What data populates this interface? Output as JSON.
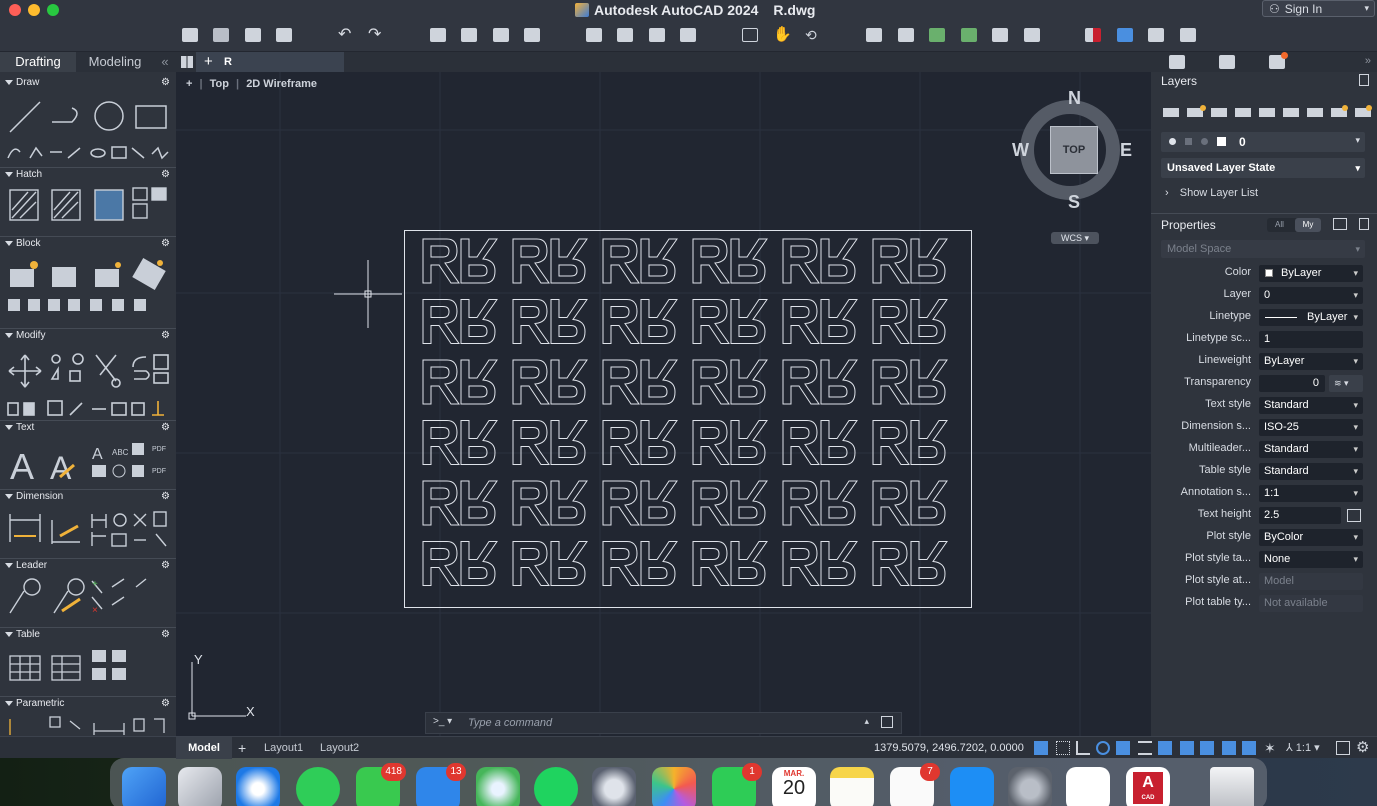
{
  "window": {
    "title": "Autodesk AutoCAD 2024",
    "filename": "R.dwg",
    "signin": "Sign In"
  },
  "left_tabs": {
    "drafting": "Drafting",
    "modeling": "Modeling",
    "collapse": "«"
  },
  "file_tab": {
    "name": "R"
  },
  "viewport": {
    "plus": "+",
    "view": "Top",
    "style": "2D Wireframe"
  },
  "viewcube": {
    "n": "N",
    "s": "S",
    "e": "E",
    "w": "W",
    "face": "TOP",
    "wcs": "WCS"
  },
  "ucs": {
    "x": "X",
    "y": "Y"
  },
  "palette_sections": [
    "Draw",
    "Hatch",
    "Block",
    "Modify",
    "Text",
    "Dimension",
    "Leader",
    "Table",
    "Parametric"
  ],
  "layers": {
    "title": "Layers",
    "current_layer": "0",
    "layer_state": "Unsaved Layer State",
    "show_list": "Show Layer List"
  },
  "properties": {
    "title": "Properties",
    "toggle_all": "All",
    "toggle_my": "My",
    "space": "Model Space",
    "rows": [
      {
        "label": "Color",
        "value": "ByLayer"
      },
      {
        "label": "Layer",
        "value": "0"
      },
      {
        "label": "Linetype",
        "value": "ByLayer"
      },
      {
        "label": "Linetype sc...",
        "value": "1"
      },
      {
        "label": "Lineweight",
        "value": "ByLayer"
      },
      {
        "label": "Transparency",
        "value": "0"
      },
      {
        "label": "Text style",
        "value": "Standard"
      },
      {
        "label": "Dimension s...",
        "value": "ISO-25"
      },
      {
        "label": "Multileader...",
        "value": "Standard"
      },
      {
        "label": "Table style",
        "value": "Standard"
      },
      {
        "label": "Annotation s...",
        "value": "1:1"
      },
      {
        "label": "Text height",
        "value": "2.5"
      },
      {
        "label": "Plot style",
        "value": "ByColor"
      },
      {
        "label": "Plot style ta...",
        "value": "None"
      },
      {
        "label": "Plot style at...",
        "value": "Model"
      },
      {
        "label": "Plot table ty...",
        "value": "Not available"
      }
    ]
  },
  "command": {
    "prompt": ">_",
    "placeholder": "Type a command"
  },
  "status": {
    "model": "Model",
    "layout1": "Layout1",
    "layout2": "Layout2",
    "coords": "1379.5079, 2496.7202, 0.0000",
    "scale": "1:1"
  },
  "dock": {
    "badges": {
      "messages": "418",
      "mail": "13",
      "facetime": "1",
      "reminders": "7"
    },
    "calendar_month": "MAR.",
    "calendar_day": "20",
    "cad_label": "CAD"
  },
  "colors": {
    "accent": "#3d7bd5",
    "canvas": "#212631",
    "panel": "#2f343d"
  }
}
